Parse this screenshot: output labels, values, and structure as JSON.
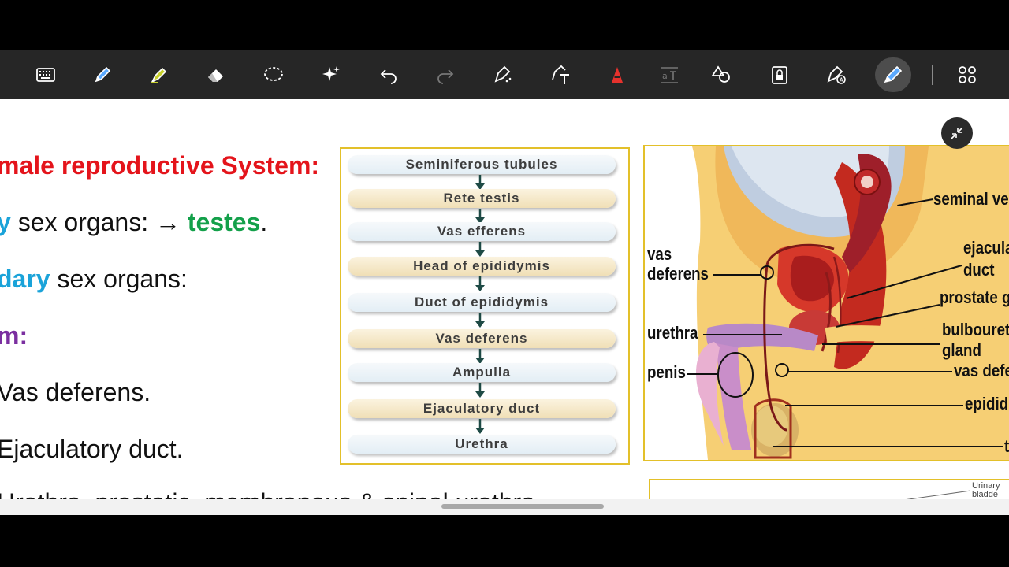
{
  "toolbar": {
    "tools": [
      {
        "name": "keyboard-icon",
        "active": false
      },
      {
        "name": "pen-icon",
        "active": false
      },
      {
        "name": "highlighter-icon",
        "active": false
      },
      {
        "name": "eraser-icon",
        "active": false
      },
      {
        "name": "lasso-icon",
        "active": false
      },
      {
        "name": "sparkle-icon",
        "active": false
      },
      {
        "name": "undo-icon",
        "active": false
      },
      {
        "name": "redo-icon",
        "active": false,
        "disabled": true
      },
      {
        "name": "shape-pen-icon",
        "active": false
      },
      {
        "name": "text-tool-icon",
        "active": false
      },
      {
        "name": "text-color-icon",
        "active": false,
        "color": "#e6322d"
      },
      {
        "name": "text-format-icon",
        "active": false,
        "disabled": true
      },
      {
        "name": "shapes-icon",
        "active": false
      },
      {
        "name": "lock-icon",
        "active": false
      },
      {
        "name": "pen-settings-icon",
        "active": false
      },
      {
        "name": "laser-pen-icon",
        "active": true
      },
      {
        "name": "apps-grid-icon",
        "active": false
      }
    ]
  },
  "slide": {
    "line1": "male reproductive System:",
    "line2_highlight": "y",
    "line2_text": " sex organs: ",
    "line2_arrow": "→",
    "line2_organ": "testes",
    "line2_end": ".",
    "line3_highlight": "dary",
    "line3_text": " sex organs:",
    "line4": "m:",
    "line5": "Vas deferens.",
    "line6": "Ejaculatory duct.",
    "line7": "Urethra, prostatic, membranous & spinal urethra"
  },
  "flowchart": {
    "steps": [
      "Seminiferous tubules",
      "Rete testis",
      "Vas efferens",
      "Head of epididymis",
      "Duct of epididymis",
      "Vas deferens",
      "Ampulla",
      "Ejaculatory duct",
      "Urethra"
    ]
  },
  "anatomy": {
    "labels": {
      "seminal": "seminal ve",
      "ejacula1": "ejacula",
      "ejacula2": "duct",
      "prostate": "prostate g",
      "bulbo1": "bulbouret",
      "bulbo2": "gland",
      "vasdef_right": "vas defe",
      "epidid": "epidid",
      "t": "t",
      "vas1": "vas",
      "vas2": "deferens",
      "urethra": "urethra",
      "penis": "penis"
    },
    "second_labels": {
      "l1": "Urinary",
      "l2": "bladde"
    }
  },
  "colors": {
    "accent_red": "#e4141b",
    "accent_blue": "#1aa3d9",
    "accent_green": "#13a04a",
    "accent_purple": "#7b2fa0",
    "frame": "#e3c02a"
  }
}
